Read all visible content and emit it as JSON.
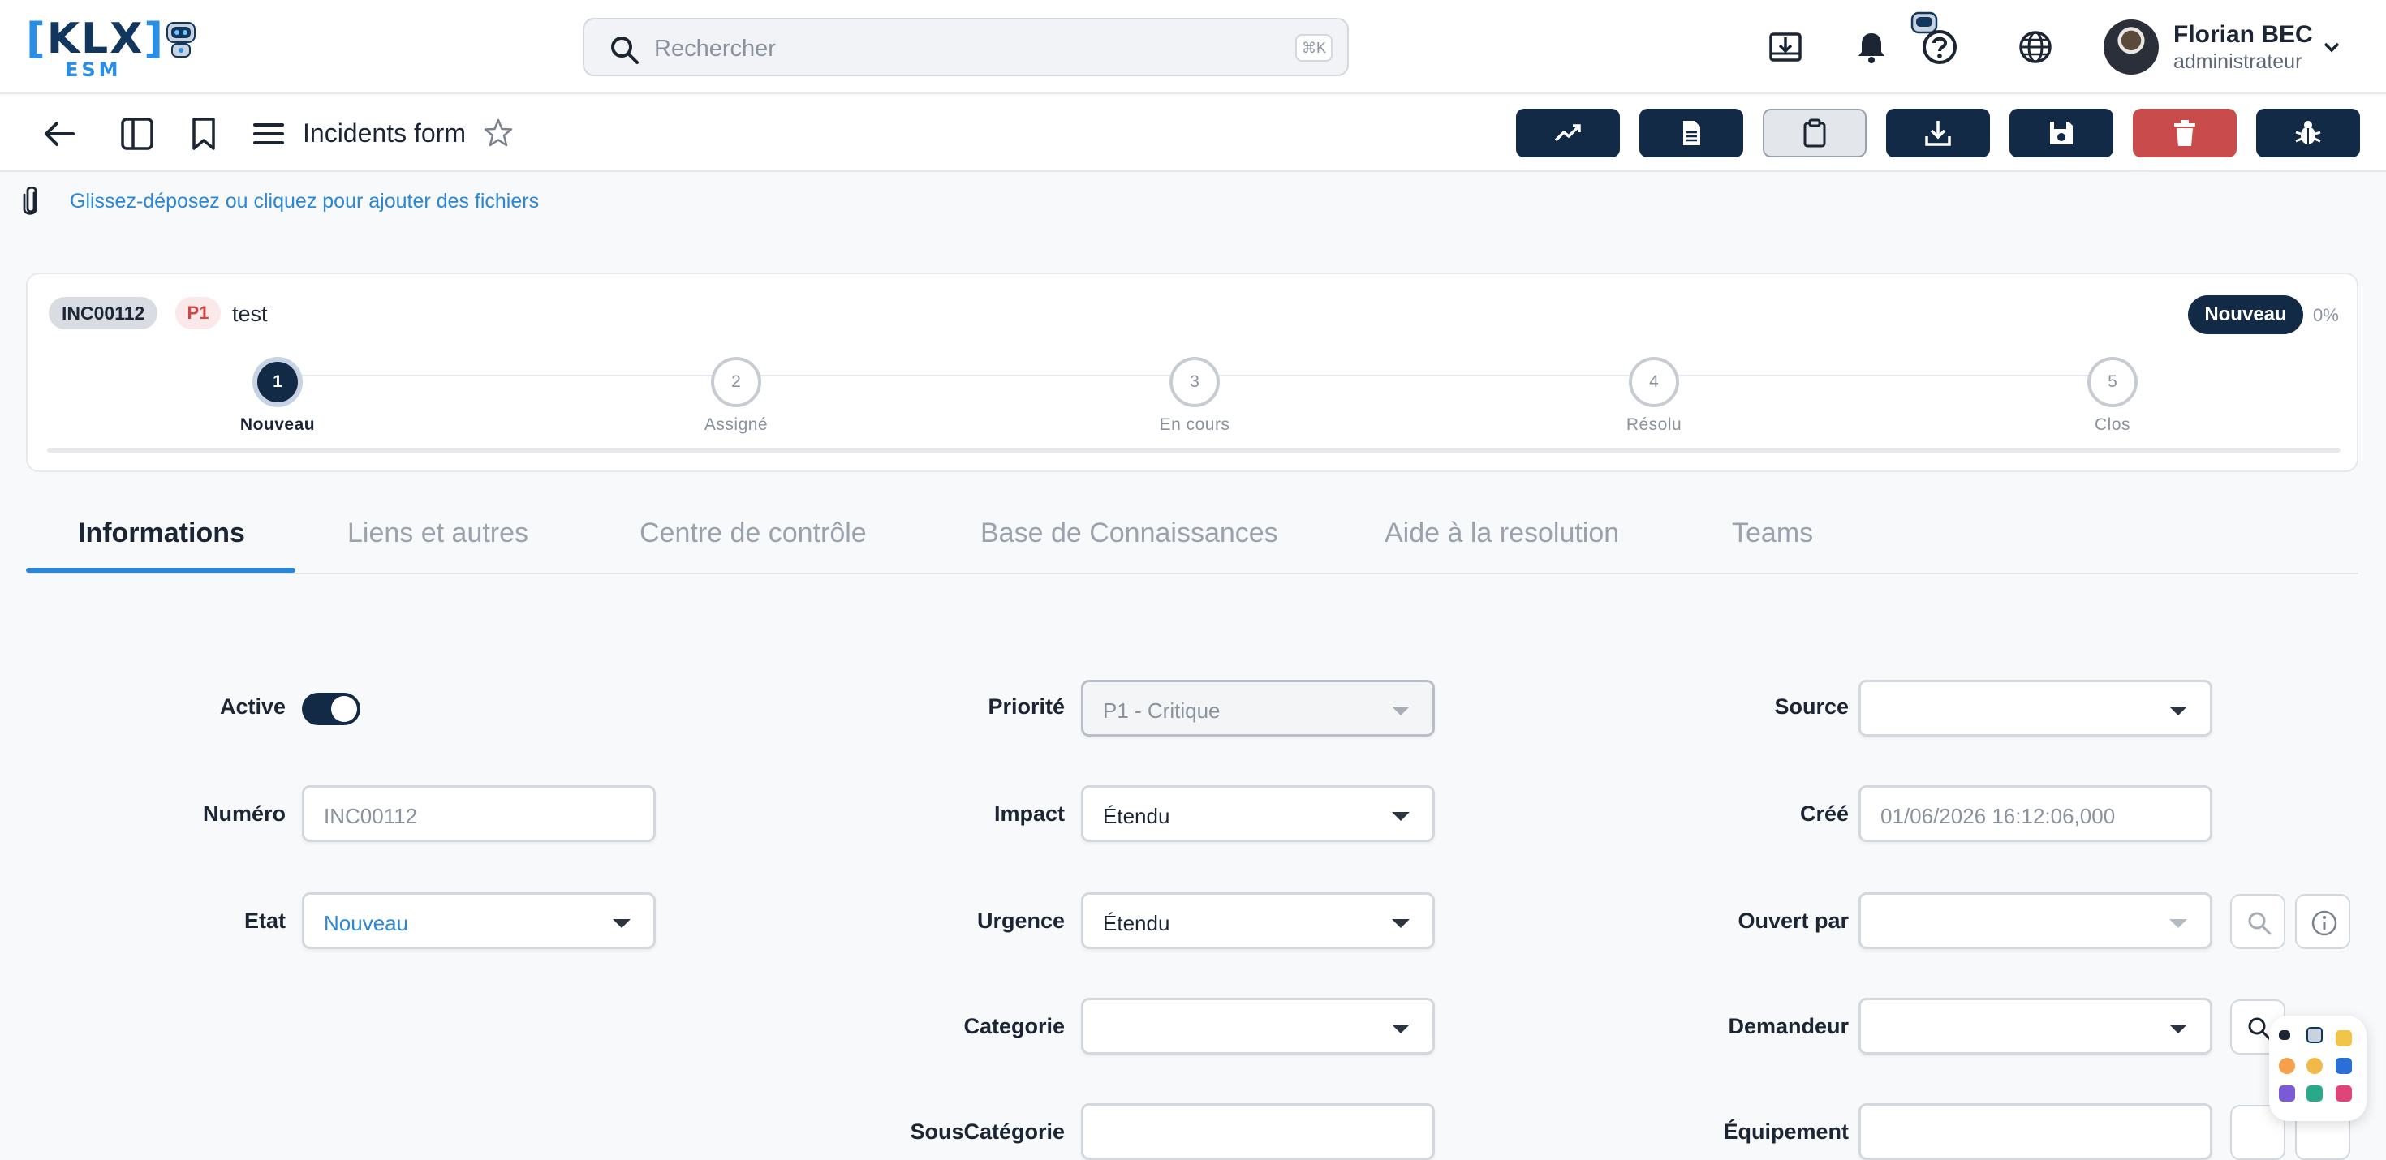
{
  "header": {
    "logo": {
      "brand": "KLX",
      "sub": "ESM"
    },
    "search": {
      "placeholder": "Rechercher",
      "shortcut": "⌘K"
    },
    "icons": [
      "download-tray-icon",
      "bell-icon",
      "help-assistant-icon",
      "globe-icon"
    ],
    "user": {
      "name": "Florian BEC",
      "role": "administrateur"
    }
  },
  "toolbar": {
    "title": "Incidents form",
    "actions": [
      {
        "name": "trend-button",
        "icon": "trend-up-icon"
      },
      {
        "name": "document-button",
        "icon": "document-icon"
      },
      {
        "name": "clipboard-button",
        "icon": "clipboard-icon"
      },
      {
        "name": "download-button",
        "icon": "download-icon"
      },
      {
        "name": "save-button",
        "icon": "save-icon"
      },
      {
        "name": "delete-button",
        "icon": "trash-icon"
      },
      {
        "name": "debug-button",
        "icon": "bug-icon"
      }
    ]
  },
  "attachments": {
    "text": "Glissez-déposez ou cliquez pour ajouter des fichiers"
  },
  "record": {
    "id": "INC00112",
    "priority": "P1",
    "title": "test",
    "state": "Nouveau",
    "progress": "0%",
    "progress_value": 0,
    "steps": [
      {
        "num": "1",
        "label": "Nouveau",
        "active": true
      },
      {
        "num": "2",
        "label": "Assigné"
      },
      {
        "num": "3",
        "label": "En cours"
      },
      {
        "num": "4",
        "label": "Résolu"
      },
      {
        "num": "5",
        "label": "Clos"
      }
    ]
  },
  "tabs": [
    {
      "label": "Informations",
      "active": true
    },
    {
      "label": "Liens et autres"
    },
    {
      "label": "Centre de contrôle"
    },
    {
      "label": "Base de Connaissances"
    },
    {
      "label": "Aide à la resolution"
    },
    {
      "label": "Teams"
    }
  ],
  "form": {
    "active": {
      "label": "Active",
      "value": true
    },
    "numero": {
      "label": "Numéro",
      "value": "INC00112"
    },
    "etat": {
      "label": "Etat",
      "value": "Nouveau"
    },
    "priorite": {
      "label": "Priorité",
      "value": "P1 - Critique"
    },
    "impact": {
      "label": "Impact",
      "value": "Étendu"
    },
    "urgence": {
      "label": "Urgence",
      "value": "Étendu"
    },
    "categorie": {
      "label": "Categorie",
      "value": ""
    },
    "souscategorie": {
      "label": "SousCatégorie",
      "value": ""
    },
    "source": {
      "label": "Source",
      "value": ""
    },
    "cree": {
      "label": "Créé",
      "value": "01/06/2026 16:12:06,000"
    },
    "ouvert_par": {
      "label": "Ouvert par",
      "value": ""
    },
    "demandeur": {
      "label": "Demandeur",
      "value": ""
    },
    "equipement": {
      "label": "Équipement",
      "value": ""
    }
  },
  "colors": {
    "primary": "#122a45",
    "accent": "#2a86d6",
    "danger": "#c94b4b",
    "priority": "#d04646"
  }
}
